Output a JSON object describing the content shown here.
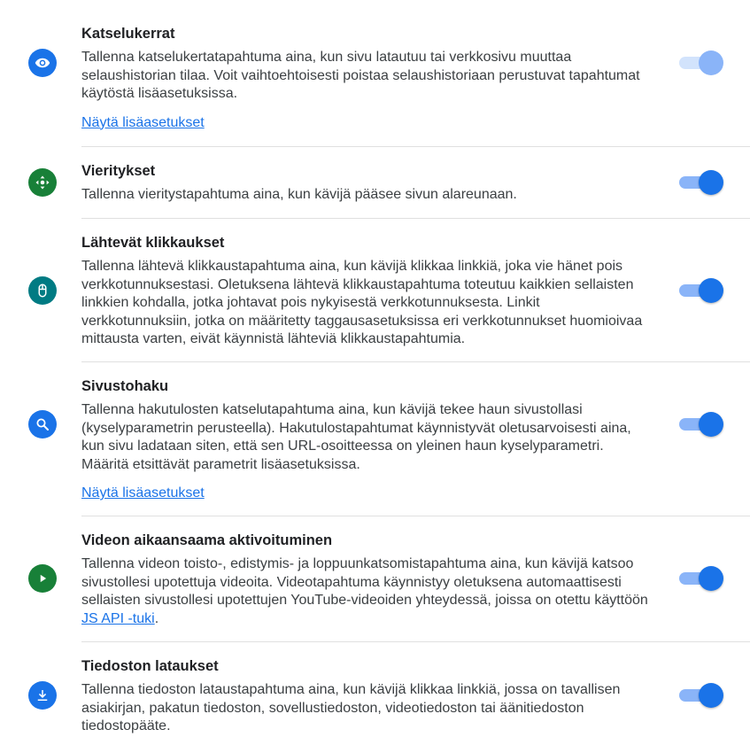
{
  "colors": {
    "blue": "#1a73e8",
    "green": "#188038",
    "teal": "#007b83"
  },
  "items": [
    {
      "title": "Katselukerrat",
      "desc": "Tallenna katselukertatapahtuma aina, kun sivu latautuu tai verkkosivu muuttaa selaushistorian tilaa. Voit vaihtoehtoisesti poistaa selaushistoriaan perustuvat tapahtumat käytöstä lisäasetuksissa.",
      "more": "Näytä lisäasetukset",
      "icon": "eye-icon",
      "enabled": true,
      "toggle_disabled": true
    },
    {
      "title": "Vieritykset",
      "desc": "Tallenna vieritystapahtuma aina, kun kävijä pääsee sivun alareunaan.",
      "icon": "scroll-arrows-icon",
      "enabled": true
    },
    {
      "title": "Lähtevät klikkaukset",
      "desc": "Tallenna lähtevä klikkaustapahtuma aina, kun kävijä klikkaa linkkiä, joka vie hänet pois verkkotunnuksestasi. Oletuksena lähtevä klikkaustapahtuma toteutuu kaikkien sellaisten linkkien kohdalla, jotka johtavat pois nykyisestä verkkotunnuksesta. Linkit verkkotunnuksiin, jotka on määritetty taggausasetuksissa eri verkkotunnukset huomioivaa mittausta varten, eivät käynnistä lähteviä klikkaustapahtumia.",
      "icon": "mouse-icon",
      "enabled": true
    },
    {
      "title": "Sivustohaku",
      "desc": "Tallenna hakutulosten katselutapahtuma aina, kun kävijä tekee haun sivustollasi (kyselyparametrin perusteella). Hakutulostapahtumat käynnistyvät oletusarvoisesti aina, kun sivu ladataan siten, että sen URL-osoitteessa on yleinen haun kyselyparametri. Määritä etsittävät parametrit lisäasetuksissa.",
      "more": "Näytä lisäasetukset",
      "icon": "search-icon",
      "enabled": true
    },
    {
      "title": "Videon aikaansaama aktivoituminen",
      "desc_before": "Tallenna videon toisto-, edistymis- ja loppuunkatsomistapahtuma aina, kun kävijä katsoo sivustollesi upotettuja videoita. Videotapahtuma käynnistyy oletuksena automaattisesti sellaisten sivustollesi upotettujen YouTube-videoiden yhteydessä, joissa on otettu käyttöön ",
      "desc_link": "JS API -tuki",
      "desc_after": ".",
      "icon": "play-icon",
      "enabled": true
    },
    {
      "title": "Tiedoston lataukset",
      "desc": "Tallenna tiedoston lataustapahtuma aina, kun kävijä klikkaa linkkiä, jossa on tavallisen asiakirjan, pakatun tiedoston, sovellustiedoston, videotiedoston tai äänitiedoston tiedostopääte.",
      "icon": "download-icon",
      "enabled": true
    }
  ]
}
